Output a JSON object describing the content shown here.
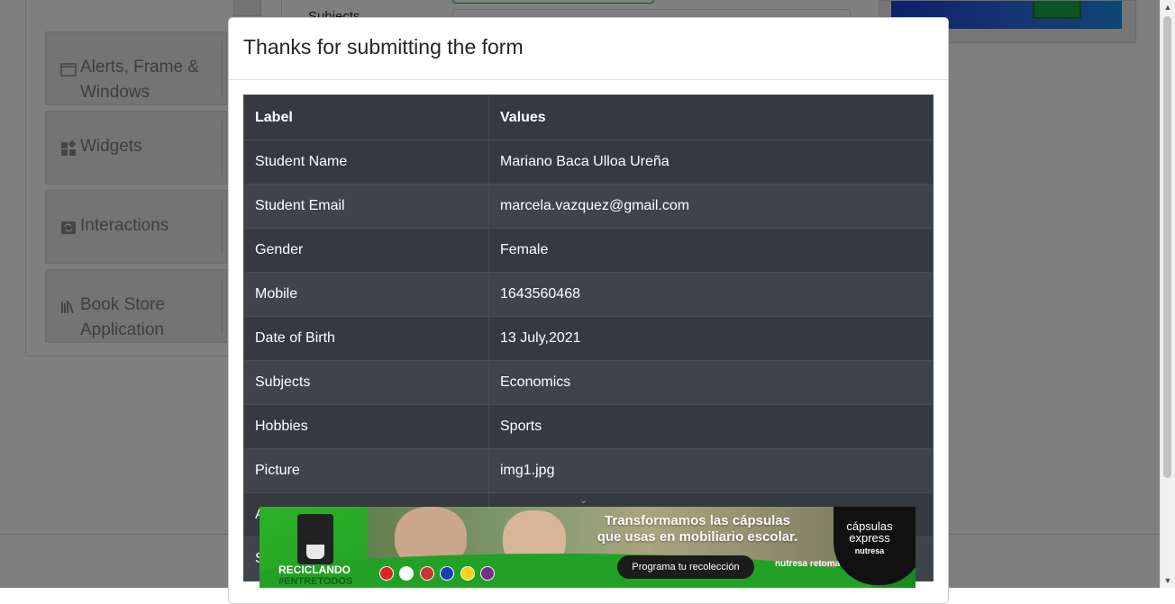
{
  "background": {
    "sidebar": {
      "items": [
        {
          "label": "Alerts, Frame & Windows",
          "icon": "window-icon"
        },
        {
          "label": "Widgets",
          "icon": "widgets-icon"
        },
        {
          "label": "Interactions",
          "icon": "interactions-icon"
        },
        {
          "label": "Book Store Application",
          "icon": "books-icon"
        }
      ]
    },
    "form_fragment": {
      "label": "Subjects"
    }
  },
  "modal": {
    "title": "Thanks for submitting the form",
    "table": {
      "headers": [
        "Label",
        "Values"
      ],
      "rows": [
        {
          "label": "Student Name",
          "value": "Mariano Baca Ulloa Ureña"
        },
        {
          "label": "Student Email",
          "value": "marcela.vazquez@gmail.com"
        },
        {
          "label": "Gender",
          "value": "Female"
        },
        {
          "label": "Mobile",
          "value": "1643560468"
        },
        {
          "label": "Date of Birth",
          "value": "13 July,2021"
        },
        {
          "label": "Subjects",
          "value": "Economics"
        },
        {
          "label": "Hobbies",
          "value": "Sports"
        },
        {
          "label": "Picture",
          "value": "img1.jpg"
        },
        {
          "label": "A",
          "value": ""
        },
        {
          "label": "S",
          "value": ""
        }
      ]
    }
  },
  "ad": {
    "headline_1": "Transformamos las cápsulas",
    "headline_2": "que usas en mobiliario escolar.",
    "campaign": "RECICLANDO",
    "hashtag": "#ENTRETODOS",
    "cta": "Programa tu recolección",
    "brand_left": "nutresa retoma",
    "brand_right_1": "cápsulas",
    "brand_right_2": "express",
    "brand_right_3": "nutresa",
    "colors": {
      "green": "#1f9b23",
      "dark": "#111111"
    }
  },
  "colors": {
    "table_dark": "#343a40",
    "table_stripe": "#3e444a",
    "overlay": "rgba(0,0,0,0.5)"
  }
}
